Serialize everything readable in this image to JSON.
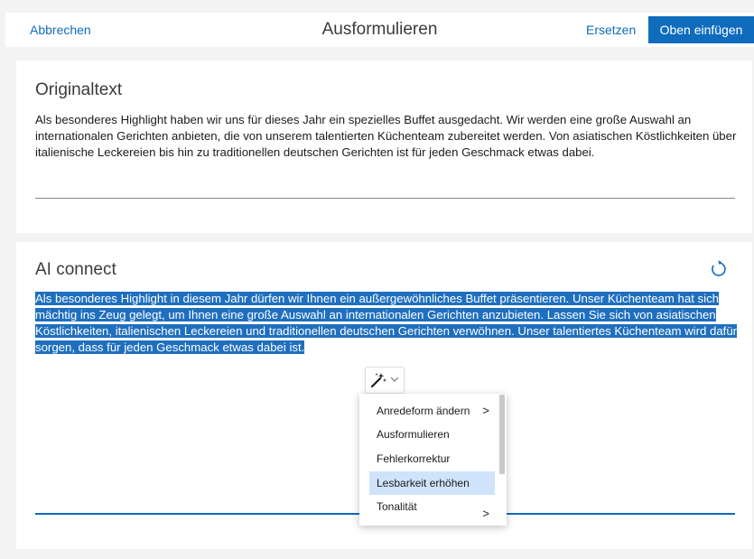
{
  "header": {
    "cancel_label": "Abbrechen",
    "title": "Ausformulieren",
    "replace_label": "Ersetzen",
    "insert_label": "Oben einfügen"
  },
  "original": {
    "heading": "Originaltext",
    "text": "Als besonderes Highlight haben wir uns für dieses Jahr ein spezielles Buffet ausgedacht. Wir werden eine große Auswahl an internationalen Gerichten anbieten, die von unserem talentierten Küchenteam zubereitet werden. Von asiatischen Köstlichkeiten über italienische Leckereien bis hin zu traditionellen deutschen Gerichten ist für jeden Geschmack etwas dabei."
  },
  "ai": {
    "heading": "AI connect",
    "text": "Als besonderes Highlight in diesem Jahr dürfen wir Ihnen ein außergewöhnliches Buffet präsentieren. Unser Küchenteam hat sich mächtig ins Zeug gelegt, um Ihnen eine große Auswahl an internationalen Gerichten anzubieten. Lassen Sie sich von asiatischen Köstlichkeiten, italienischen Leckereien und traditionellen deutschen Gerichten verwöhnen. Unser talentiertes Küchenteam wird dafür sorgen, dass für jeden Geschmack etwas dabei ist."
  },
  "menu": {
    "items": [
      {
        "label": "Anredeform ändern",
        "arrow": ">"
      },
      {
        "label": "Ausformulieren"
      },
      {
        "label": "Fehlerkorrektur"
      },
      {
        "label": "Lesbarkeit erhöhen"
      },
      {
        "label": "Tonalität",
        "arrow": ">"
      }
    ]
  },
  "colors": {
    "accent": "#0f6cbd",
    "selection": "#1f6fbf",
    "menu_hover": "#cfe4fa"
  }
}
